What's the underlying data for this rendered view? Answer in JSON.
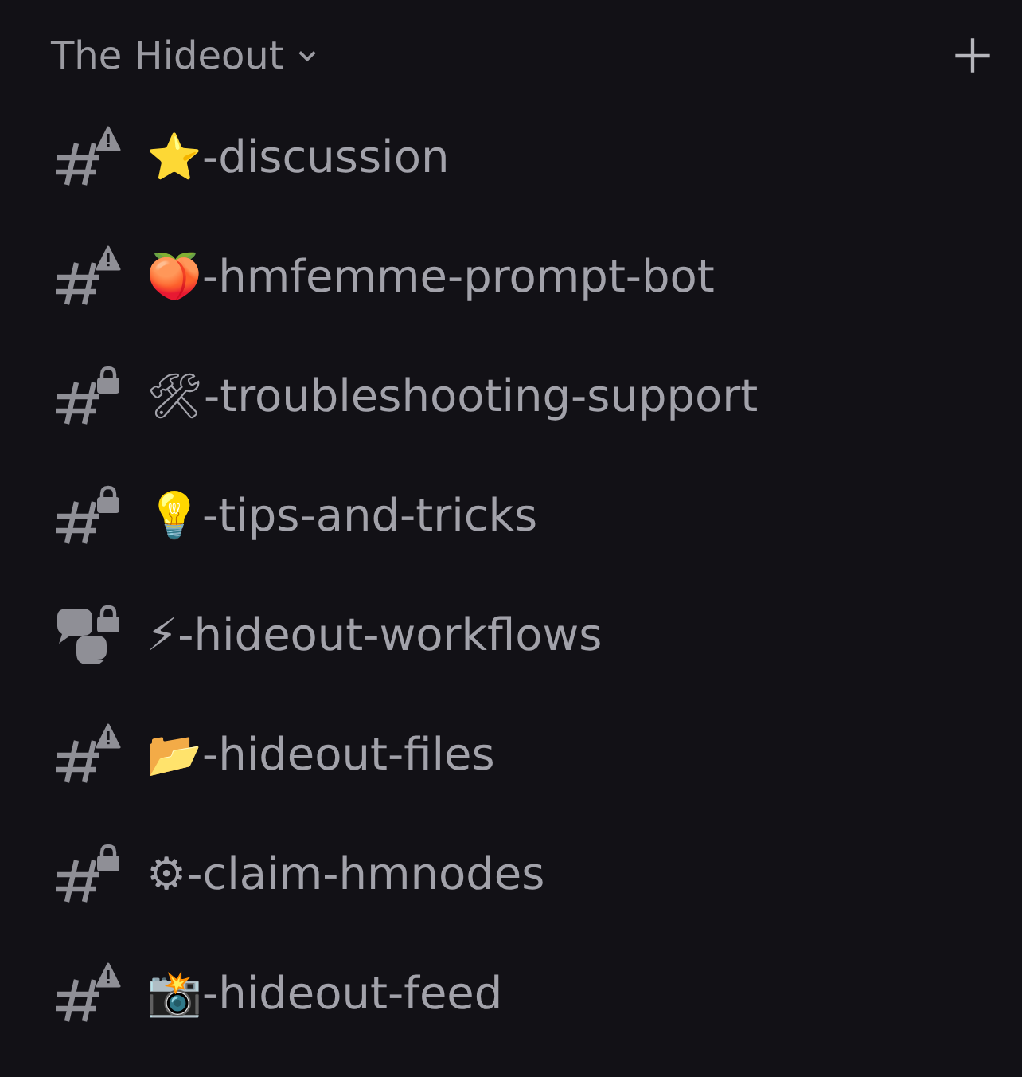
{
  "category": {
    "name": "The Hideout",
    "expanded": true
  },
  "channels": [
    {
      "name": "⭐-discussion",
      "kind": "text",
      "locked": false,
      "warning": true
    },
    {
      "name": "🍑-hmfemme-prompt-bot",
      "kind": "text",
      "locked": false,
      "warning": true
    },
    {
      "name": "🛠-troubleshooting-support",
      "kind": "text",
      "locked": true,
      "warning": false
    },
    {
      "name": "💡-tips-and-tricks",
      "kind": "text",
      "locked": true,
      "warning": false
    },
    {
      "name": "⚡-hideout-workflows",
      "kind": "forum",
      "locked": true,
      "warning": false
    },
    {
      "name": "📂-hideout-files",
      "kind": "text",
      "locked": false,
      "warning": true
    },
    {
      "name": "⚙-claim-hmnodes",
      "kind": "text",
      "locked": true,
      "warning": false
    },
    {
      "name": "📸-hideout-feed",
      "kind": "text",
      "locked": false,
      "warning": true
    }
  ]
}
